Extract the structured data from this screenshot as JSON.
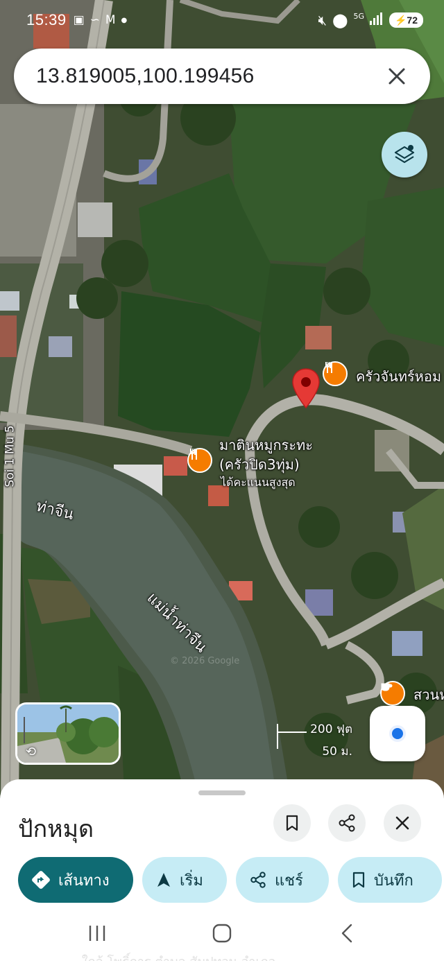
{
  "status_bar": {
    "time": "15:39",
    "battery": "72",
    "network": "5G"
  },
  "search": {
    "query": "13.819005,100.199456"
  },
  "map": {
    "places": [
      {
        "name": "ครัวจันทร์หอม",
        "icon": "restaurant-icon"
      },
      {
        "name": "มาตินหมูกระทะ",
        "name2": "(ครัวปิด3ทุ่ม)",
        "note": "ได้คะแนนสูงสุด",
        "icon": "restaurant-icon"
      },
      {
        "name": "สวนห",
        "icon": "cafe-icon"
      }
    ],
    "road_label": "Soi 1 Mu 5",
    "area_label": "ท่าจีน",
    "river_label": "แม่น้ำท่าจีน",
    "watermark": "© 2026 Google",
    "scale": {
      "imperial": "200 ฟุต",
      "metric": "50 ม."
    }
  },
  "sheet": {
    "title": "ปักหมุด",
    "actions": [
      {
        "label": "เส้นทาง",
        "icon": "directions-icon"
      },
      {
        "label": "เริ่ม",
        "icon": "navigation-arrow-icon"
      },
      {
        "label": "แชร์",
        "icon": "share-icon"
      },
      {
        "label": "บันทึก",
        "icon": "bookmark-icon"
      }
    ],
    "footer_text": "ใกล้ โพธิ์การ ตำบล สัมปทวน อำเภอ"
  },
  "colors": {
    "primary": "#0f6b73",
    "chip_secondary": "#c6ecf5",
    "pin": "#e53935",
    "poi": "#f57c00",
    "location_dot": "#1a73e8"
  }
}
